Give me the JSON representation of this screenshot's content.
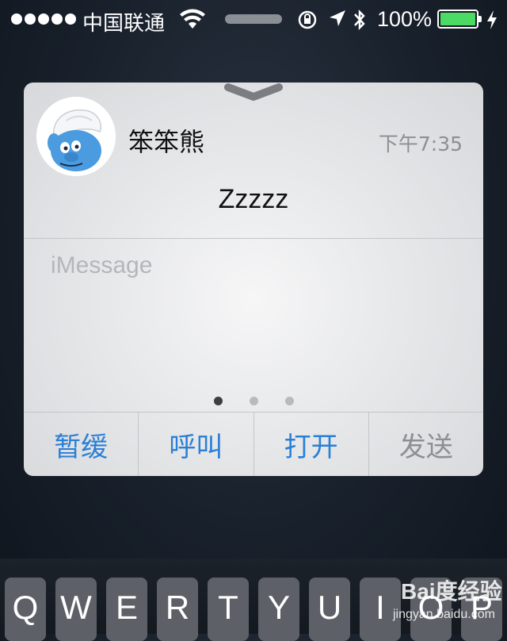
{
  "status_bar": {
    "carrier": "中国联通",
    "battery_percent_label": "100%",
    "battery_level": 1.0
  },
  "notification": {
    "sender": "笨笨熊",
    "time": "下午7:35",
    "message": "Zzzzz",
    "reply_placeholder": "iMessage",
    "page_indicator": {
      "count": 3,
      "active_index": 0
    },
    "actions": [
      {
        "label": "暂缓"
      },
      {
        "label": "呼叫"
      },
      {
        "label": "打开"
      },
      {
        "label": "发送"
      }
    ]
  },
  "keyboard": {
    "keys": [
      "Q",
      "W",
      "E",
      "R",
      "T",
      "Y",
      "U",
      "I",
      "O",
      "P"
    ]
  },
  "watermark": {
    "logo": "Bai度经验",
    "url": "jingyan.baidu.com"
  },
  "colors": {
    "action_blue": "#2a7fd6",
    "battery_green": "#4cd964"
  }
}
